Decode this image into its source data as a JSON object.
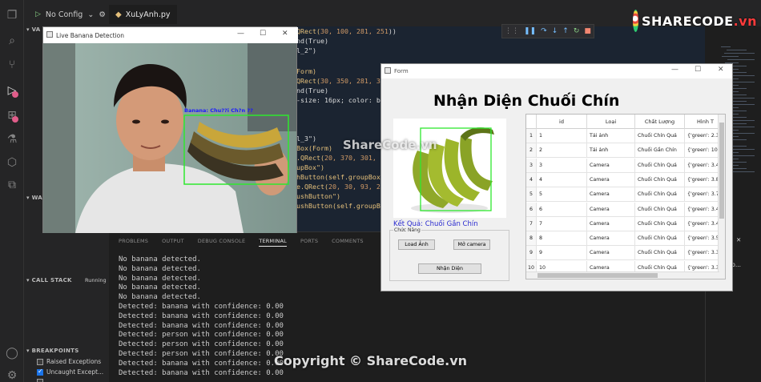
{
  "vscode": {
    "run_config": "No Config",
    "file_tab": "XuLyAnh.py",
    "side": {
      "variables": "VA",
      "watch": "WA",
      "call_stack": "CALL STACK",
      "call_stack_status": "Running",
      "breakpoints": "BREAKPOINTS",
      "bp_items": [
        {
          "label": "Raised Exceptions",
          "checked": false
        },
        {
          "label": "Uncaught Except...",
          "checked": true
        },
        {
          "label": "",
          "checked": false
        }
      ]
    },
    "code_lines": [
      {
        "a": "QRect(",
        "b": "30, 100, 281, 251",
        "c": "))"
      },
      {
        "a": "nd(True)",
        "b": "",
        "c": ""
      },
      {
        "a": "l_2\")",
        "b": "",
        "c": ""
      },
      {
        "a": "Form)",
        "b": "",
        "c": ""
      },
      {
        "a": "QRect(",
        "b": "30, 350, 281, 30",
        "c": ""
      },
      {
        "a": "nd(True)",
        "b": "",
        "c": ""
      },
      {
        "a": "-size: 16px; color: bl",
        "b": "",
        "c": ""
      },
      {
        "a": "l_3\")",
        "b": "",
        "c": ""
      },
      {
        "a": "l_3\")",
        "b": "",
        "c": ""
      },
      {
        "a": "Box(Form)",
        "b": "",
        "c": ""
      },
      {
        "a": ".QRect(",
        "b": "20, 370, 301, 1",
        "c": ""
      },
      {
        "a": "upBox\")",
        "b": "",
        "c": ""
      },
      {
        "a": "hButton(self.groupBox)",
        "b": "",
        "c": ""
      },
      {
        "a": "e.QRect(",
        "b": "20, 30, 93, 2",
        "c": ""
      },
      {
        "a": "ushButton\")",
        "b": "",
        "c": ""
      },
      {
        "a": "ushButton(self.groupBo",
        "b": "",
        "c": ""
      }
    ],
    "panel_tabs": [
      "PROBLEMS",
      "OUTPUT",
      "DEBUG CONSOLE",
      "TERMINAL",
      "PORTS",
      "COMMENTS"
    ],
    "active_panel_tab": "TERMINAL",
    "terminal_lines": [
      "No banana detected.",
      "No banana detected.",
      "No banana detected.",
      "No banana detected.",
      "No banana detected.",
      "Detected: banana with confidence: 0.00",
      "Detected: banana with confidence: 0.00",
      "Detected: banana with confidence: 0.00",
      "Detected: person with confidence: 0.00",
      "Detected: person with confidence: 0.00",
      "Detected: person with confidence: 0.00",
      "Detected: banana with confidence: 0.00",
      "Detected: banana with confidence: 0.00"
    ],
    "right_panel_text": "on Deb..."
  },
  "camera_window": {
    "title": "Live Banana Detection",
    "detection_label": "Banana: Chu??i Ch?n ??"
  },
  "form_window": {
    "title": "Form",
    "heading": "Nhận Diện Chuối Chín",
    "result": "Kết Quả: Chuối Gần Chín",
    "group_title": "Chức Năng",
    "buttons": {
      "load": "Load Ảnh",
      "camera": "Mở camera",
      "detect": "Nhận Diện"
    },
    "table": {
      "headers": [
        "",
        "id",
        "Loại",
        "Chất Lượng",
        "Hình T"
      ],
      "rows": [
        [
          "1",
          "1",
          "Tải ảnh",
          "Chuối Chín Quá",
          "{'green': 2.3"
        ],
        [
          "2",
          "2",
          "Tải ảnh",
          "Chuối Gần Chín",
          "{'green': 10"
        ],
        [
          "3",
          "3",
          "Camera",
          "Chuối Chín Quá",
          "{'green': 3.4"
        ],
        [
          "4",
          "4",
          "Camera",
          "Chuối Chín Quá",
          "{'green': 3.8"
        ],
        [
          "5",
          "5",
          "Camera",
          "Chuối Chín Quá",
          "{'green': 3.7"
        ],
        [
          "6",
          "6",
          "Camera",
          "Chuối Chín Quá",
          "{'green': 3.4"
        ],
        [
          "7",
          "7",
          "Camera",
          "Chuối Chín Quá",
          "{'green': 3.4"
        ],
        [
          "8",
          "8",
          "Camera",
          "Chuối Chín Quá",
          "{'green': 3.5"
        ],
        [
          "9",
          "9",
          "Camera",
          "Chuối Chín Quá",
          "{'green': 3.3"
        ],
        [
          "10",
          "10",
          "Camera",
          "Chuối Chín Quá",
          "{'green': 3.3"
        ]
      ]
    }
  },
  "watermarks": {
    "logo_main": "SHARECODE",
    "logo_suffix": ".vn",
    "center": "ShareCode.vn",
    "bottom": "Copyright © ShareCode.vn"
  },
  "colors": {
    "detection_box": "#2ee82e",
    "result_text": "#2b2bcf",
    "editor_bg": "#1b2431"
  }
}
